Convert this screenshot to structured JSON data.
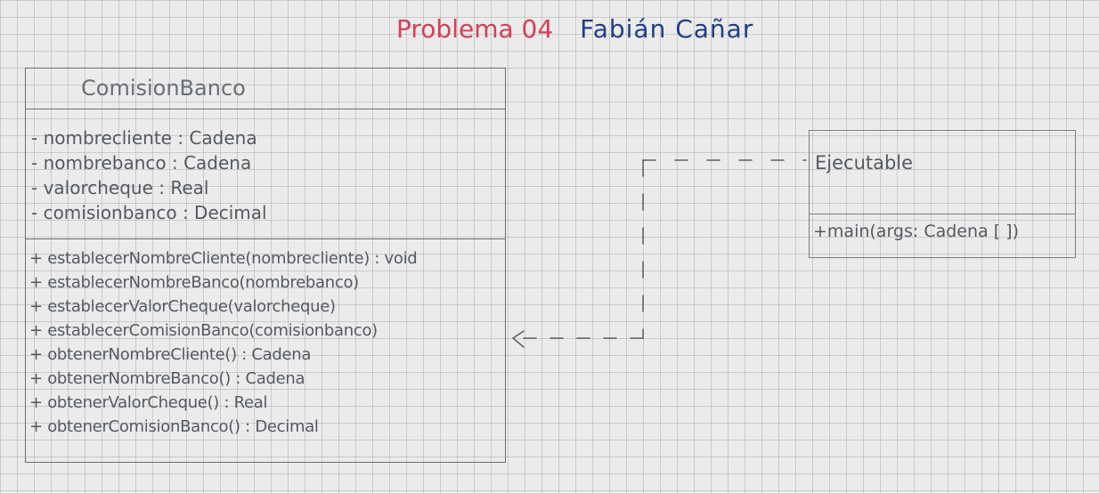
{
  "header": {
    "problem": "Problema 04",
    "author": "Fabián Cañar"
  },
  "uml_class": {
    "name": "ComisionBanco",
    "attributes": [
      "- nombrecliente : Cadena",
      "- nombrebanco : Cadena",
      "- valorcheque : Real",
      "- comisionbanco : Decimal"
    ],
    "methods": [
      "+ establecerNombreCliente(nombrecliente) : void",
      "+ establecerNombreBanco(nombrebanco)",
      "+ establecerValorCheque(valorcheque)",
      "+ establecerComisionBanco(comisionbanco)",
      "+ obtenerNombreCliente() : Cadena",
      "+ obtenerNombreBanco() : Cadena",
      "+ obtenerValorCheque() : Real",
      "+ obtenerComisionBanco() : Decimal"
    ]
  },
  "interface_class": {
    "name": "Ejecutable",
    "method": "+main(args: Cadena [ ])"
  },
  "colors": {
    "title_problem": "#d2405a",
    "title_author": "#1f3f86",
    "pencil": "#55595f"
  }
}
